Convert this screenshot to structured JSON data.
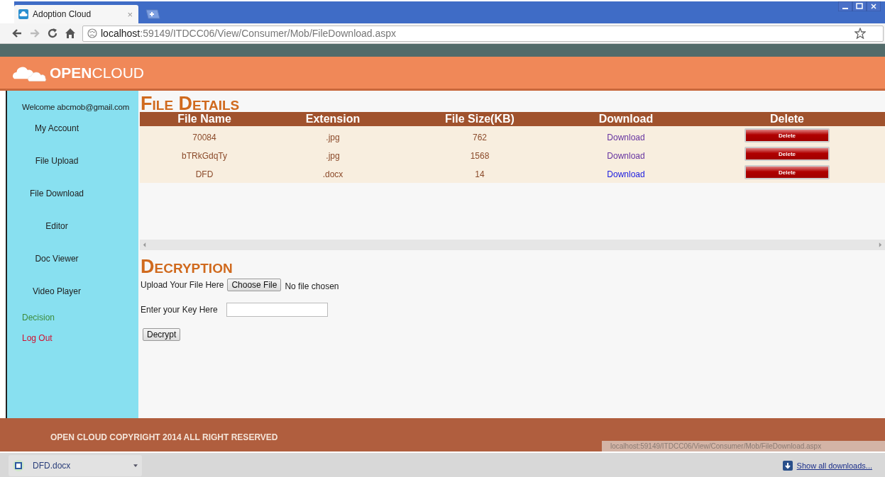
{
  "browser": {
    "tab_title": "Adoption Cloud",
    "tab_close": "×",
    "url_host": "localhost",
    "url_path": ":59149/ITDCC06/View/Consumer/Mob/FileDownload.aspx"
  },
  "header": {
    "logo_bold": "OPEN",
    "logo_light": "CLOUD"
  },
  "sidebar": {
    "welcome": "Welcome abcmob@gmail.com",
    "items": [
      {
        "label": "My Account",
        "kind": "menu"
      },
      {
        "label": "File Upload",
        "kind": "menu"
      },
      {
        "label": "File Download",
        "kind": "menu"
      },
      {
        "label": "Editor",
        "kind": "menu"
      },
      {
        "label": "Doc Viewer",
        "kind": "menu"
      },
      {
        "label": "Video Player",
        "kind": "menu"
      },
      {
        "label": "Decision",
        "kind": "link",
        "color": "#3c8c3c"
      },
      {
        "label": "Log Out",
        "kind": "link",
        "color": "#d01030"
      }
    ]
  },
  "file_details": {
    "title": "File Details",
    "table": {
      "columns": [
        "File Name",
        "Extension",
        "File Size(KB)",
        "Download",
        "Delete"
      ],
      "rows": [
        {
          "name": "70084",
          "extension": ".jpg",
          "size": "762",
          "download": "Download",
          "visited": true,
          "delete": "Delete"
        },
        {
          "name": "bTRkGdqTy",
          "extension": ".jpg",
          "size": "1568",
          "download": "Download",
          "visited": true,
          "delete": "Delete"
        },
        {
          "name": "DFD",
          "extension": ".docx",
          "size": "14",
          "download": "Download",
          "visited": false,
          "delete": "Delete"
        }
      ]
    }
  },
  "decryption": {
    "title": "Decryption",
    "upload_label": "Upload Your File Here",
    "choose_button": "Choose File",
    "file_status": "No file chosen",
    "key_label": "Enter your Key Here",
    "decrypt_button": "Decrypt"
  },
  "footer": {
    "text": "OPEN CLOUD COPYRIGHT 2014 ALL RIGHT RESERVED",
    "status_url": "localhost:59149/ITDCC06/View/Consumer/Mob/FileDownload.aspx"
  },
  "downloads": {
    "file": "DFD.docx",
    "show_all": "Show all downloads..."
  }
}
